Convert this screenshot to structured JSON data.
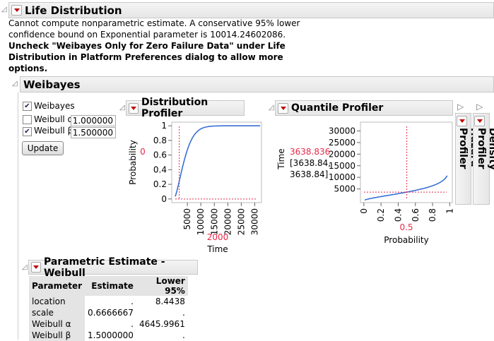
{
  "life_distribution": {
    "title": "Life Distribution",
    "message_lines": [
      "Cannot compute nonparametric estimate. A conservative 95% lower",
      "confidence bound on Exponential parameter is 10014.24602086."
    ],
    "bold_lines": [
      "Uncheck \"Weibayes Only for Zero Failure Data\" under Life",
      "Distribution in Platform Preferences dialog to allow more",
      "options."
    ]
  },
  "weibayes": {
    "title": "Weibayes",
    "weibayes_check": {
      "label": "Weibayes",
      "checked": true
    },
    "alpha": {
      "label": "Weibull α",
      "checked": false,
      "value": "1.000000"
    },
    "beta": {
      "label": "Weibull β",
      "checked": true,
      "value": "1.500000"
    },
    "update_label": "Update"
  },
  "distribution_profiler": {
    "title": "Distribution Profiler",
    "ylabel": "Probability",
    "xlabel": "Time",
    "current_y": "0",
    "current_x": "2000",
    "yticks": [
      "0",
      "0.2",
      "0.4",
      "0.6",
      "0.8",
      "1"
    ],
    "xticks": [
      "5000",
      "10000",
      "15000",
      "20000",
      "25000",
      "30000"
    ]
  },
  "quantile_profiler": {
    "title": "Quantile Profiler",
    "ylabel": "Time",
    "xlabel": "Probability",
    "current_y": "3638.836",
    "ci_line1": "[3638.84,",
    "ci_line2": "3638.84]",
    "current_x": "0.5",
    "yticks": [
      "5000",
      "10000",
      "15000",
      "20000",
      "25000",
      "30000"
    ],
    "xticks": [
      "0",
      "0.2",
      "0.4",
      "0.6",
      "0.8",
      "1"
    ]
  },
  "hazard_profiler": {
    "title": "Hazard Profiler"
  },
  "density_profiler": {
    "title": "Density Profiler"
  },
  "parametric_estimate": {
    "title": "Parametric Estimate - Weibull",
    "columns": [
      "Parameter",
      "Estimate",
      "Lower 95%"
    ],
    "rows": [
      [
        "location",
        ".",
        "8.4438"
      ],
      [
        "scale",
        "0.6666667",
        "."
      ],
      [
        "Weibull α",
        ".",
        "4645.9961"
      ],
      [
        "Weibull β",
        "1.5000000",
        "."
      ]
    ]
  },
  "chart_data": [
    {
      "type": "line",
      "title": "Distribution Profiler",
      "xlabel": "Time",
      "ylabel": "Probability",
      "xlim": [
        -800,
        32500
      ],
      "ylim": [
        -0.05,
        1.05
      ],
      "weibull_alpha": 4645.9961,
      "weibull_beta": 1.5,
      "x_range": [
        500,
        32000
      ],
      "crosshair": {
        "x": 2000,
        "y": 0
      }
    },
    {
      "type": "line",
      "title": "Quantile Profiler",
      "xlabel": "Probability",
      "ylabel": "Time",
      "xlim": [
        -0.04,
        1.03
      ],
      "ylim": [
        -900,
        33800
      ],
      "weibull_alpha": 4645.9961,
      "weibull_beta": 1.5,
      "x_range": [
        0.01,
        0.97
      ],
      "crosshair": {
        "x": 0.5,
        "y": 3638.836
      }
    }
  ],
  "colors": {
    "accent_red": "#e8294a",
    "curve": "#3a6fd8"
  }
}
